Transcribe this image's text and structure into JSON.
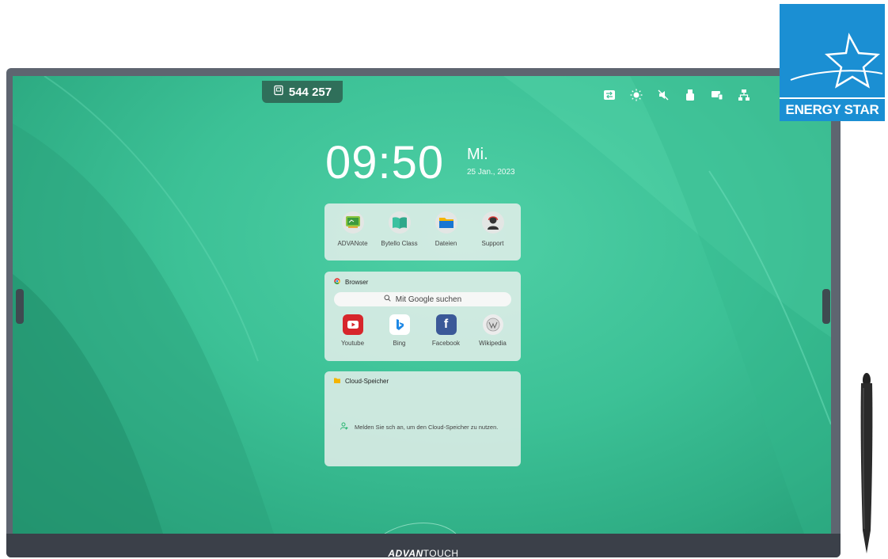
{
  "top": {
    "pin_code": "544 257"
  },
  "clock": {
    "time": "09:50",
    "day": "Mi.",
    "date": "25 Jan., 2023"
  },
  "apps": [
    {
      "label": "ADVANote",
      "icon": "whiteboard-icon"
    },
    {
      "label": "Bytello Class",
      "icon": "book-icon"
    },
    {
      "label": "Dateien",
      "icon": "folder-icon"
    },
    {
      "label": "Support",
      "icon": "support-agent-icon"
    }
  ],
  "browser": {
    "title": "Browser",
    "search_placeholder": "Mit Google suchen",
    "links": [
      {
        "label": "Youtube",
        "icon": "youtube-icon",
        "color": "#d7262b"
      },
      {
        "label": "Bing",
        "icon": "bing-icon",
        "color": "#1e88e5"
      },
      {
        "label": "Facebook",
        "icon": "facebook-icon",
        "color": "#3b5998"
      },
      {
        "label": "Wikipedia",
        "icon": "wikipedia-icon",
        "color": "#9a9a9a"
      }
    ]
  },
  "cloud": {
    "title": "Cloud-Speicher",
    "message": "Melden Sie sch an, um den Cloud-Speicher zu nutzen."
  },
  "status_icons": [
    "input-switch-icon",
    "brightness-icon",
    "mute-icon",
    "usb-icon",
    "screen-share-icon",
    "network-icon"
  ],
  "bezel": {
    "brand_bold": "ADVAN",
    "brand_light": "TOUCH"
  },
  "badge": {
    "script": "energy",
    "label": "ENERGY STAR"
  },
  "colors": {
    "accent": "#3cc196",
    "energy_blue": "#1b8fd3"
  }
}
